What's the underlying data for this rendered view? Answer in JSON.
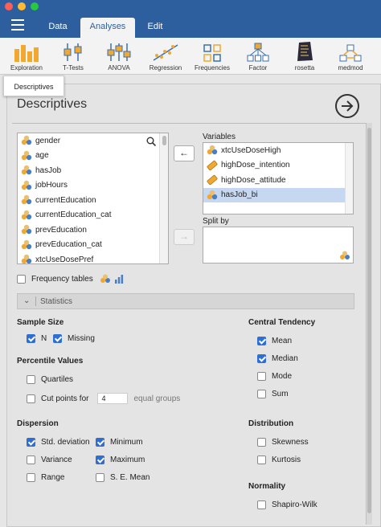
{
  "tabs": {
    "data": "Data",
    "analyses": "Analyses",
    "edit": "Edit"
  },
  "ribbon": [
    {
      "label": "Exploration",
      "icon": "exploration-icon"
    },
    {
      "label": "T-Tests",
      "icon": "ttests-icon"
    },
    {
      "label": "ANOVA",
      "icon": "anova-icon"
    },
    {
      "label": "Regression",
      "icon": "regression-icon"
    },
    {
      "label": "Frequencies",
      "icon": "frequencies-icon"
    },
    {
      "label": "Factor",
      "icon": "factor-icon"
    },
    {
      "label": "rosetta",
      "icon": "rosetta-icon"
    },
    {
      "label": "medmod",
      "icon": "medmod-icon"
    }
  ],
  "popup_tab": "Descriptives",
  "panel": {
    "title": "Descriptives"
  },
  "source_variables": [
    "gender",
    "age",
    "hasJob",
    "jobHours",
    "currentEducation",
    "currentEducation_cat",
    "prevEducation",
    "prevEducation_cat",
    "xtcUseDosePref"
  ],
  "variables_box": {
    "label": "Variables",
    "items": [
      {
        "name": "xtcUseDoseHigh",
        "type": "nominal"
      },
      {
        "name": "highDose_intention",
        "type": "continuous"
      },
      {
        "name": "highDose_attitude",
        "type": "continuous"
      },
      {
        "name": "hasJob_bi",
        "type": "nominal",
        "selected": true
      }
    ]
  },
  "split_by": {
    "label": "Split by"
  },
  "frequency_tables": {
    "label": "Frequency tables",
    "checked": false
  },
  "statistics_section": {
    "label": "Statistics"
  },
  "sample_size": {
    "title": "Sample Size",
    "n": "N",
    "missing": "Missing"
  },
  "percentile_values": {
    "title": "Percentile Values",
    "quartiles": "Quartiles",
    "cut_points": "Cut points for",
    "cut_value": "4",
    "equal_groups": "equal groups"
  },
  "dispersion": {
    "title": "Dispersion",
    "std_deviation": "Std. deviation",
    "minimum": "Minimum",
    "variance": "Variance",
    "maximum": "Maximum",
    "range": "Range",
    "se_mean": "S. E. Mean"
  },
  "central_tendency": {
    "title": "Central Tendency",
    "mean": "Mean",
    "median": "Median",
    "mode": "Mode",
    "sum": "Sum"
  },
  "distribution": {
    "title": "Distribution",
    "skewness": "Skewness",
    "kurtosis": "Kurtosis"
  },
  "normality": {
    "title": "Normality",
    "shapiro_wilk": "Shapiro-Wilk"
  },
  "colors": {
    "brand": "#2d5f9e",
    "checkbox": "#2f6fd1",
    "selection": "#c6d7f2"
  }
}
